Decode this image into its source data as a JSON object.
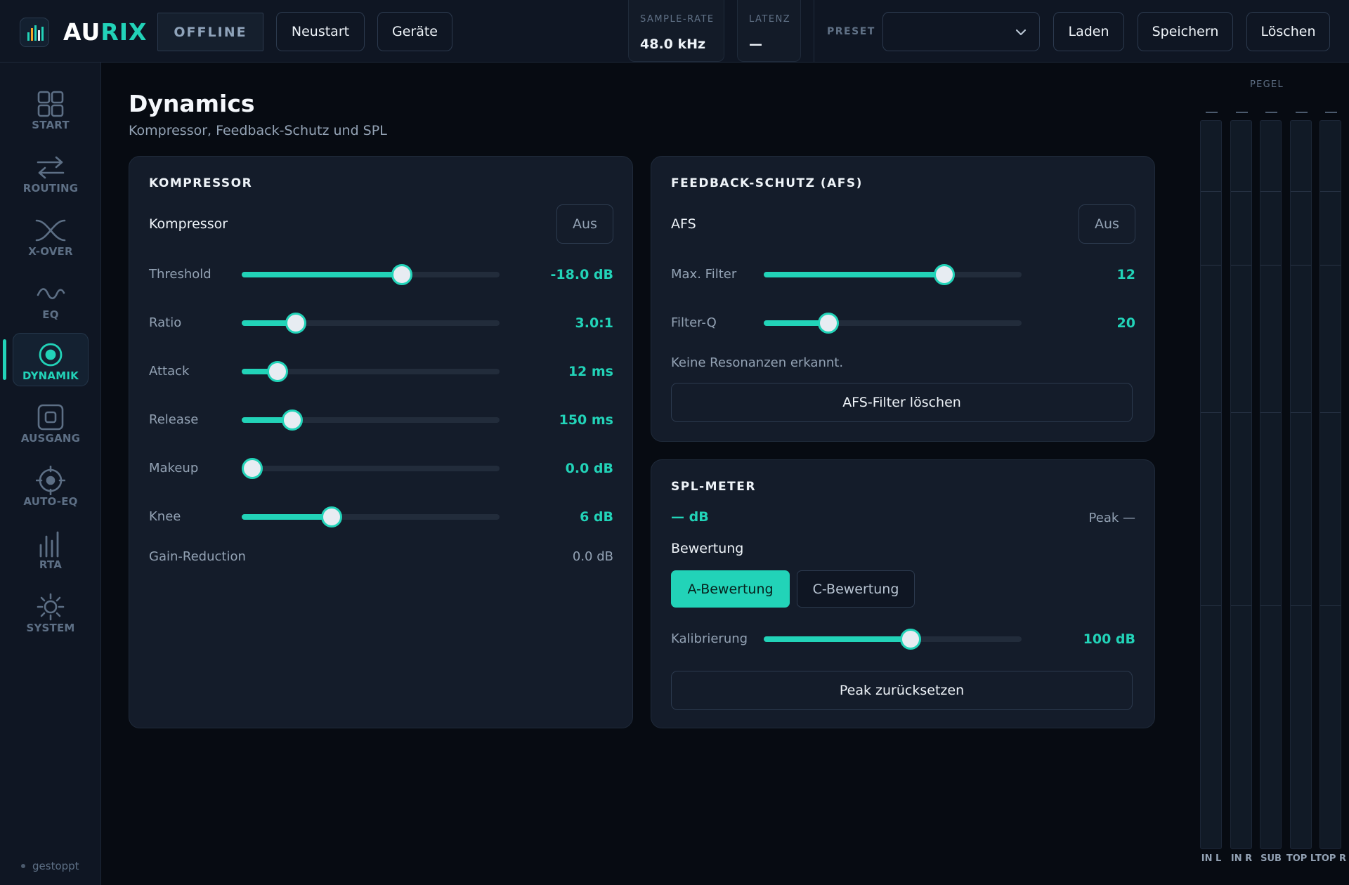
{
  "app": {
    "brand_part1": "AU",
    "brand_part2": "RIX",
    "status_badge": "OFFLINE",
    "restart_label": "Neustart",
    "devices_label": "Geräte",
    "brand_color": "#22d3b8"
  },
  "stats": {
    "sample_rate_label": "SAMPLE-RATE",
    "sample_rate_value": "48.0 kHz",
    "latency_label": "LATENZ",
    "latency_value": "—"
  },
  "preset": {
    "label": "PRESET",
    "selected": "",
    "load_label": "Laden",
    "save_label": "Speichern",
    "delete_label": "Löschen"
  },
  "sidebar": {
    "items": [
      {
        "label": "START",
        "icon": "grid-icon"
      },
      {
        "label": "ROUTING",
        "icon": "arrows-swap-icon"
      },
      {
        "label": "X-OVER",
        "icon": "crossover-icon"
      },
      {
        "label": "EQ",
        "icon": "wave-icon"
      },
      {
        "label": "DYNAMIK",
        "icon": "target-icon",
        "active": true
      },
      {
        "label": "AUSGANG",
        "icon": "output-icon"
      },
      {
        "label": "AUTO-EQ",
        "icon": "crosshair-icon"
      },
      {
        "label": "RTA",
        "icon": "bars-icon"
      },
      {
        "label": "SYSTEM",
        "icon": "gear-icon"
      }
    ],
    "status": "gestoppt"
  },
  "page": {
    "title": "Dynamics",
    "subtitle": "Kompressor, Feedback-Schutz und SPL"
  },
  "compressor": {
    "title": "KOMPRESSOR",
    "enable_label": "Kompressor",
    "toggle_label": "Aus",
    "rows": [
      {
        "label": "Threshold",
        "value": "-18.0 dB",
        "fraction": 0.62
      },
      {
        "label": "Ratio",
        "value": "3.0:1",
        "fraction": 0.21
      },
      {
        "label": "Attack",
        "value": "12 ms",
        "fraction": 0.14
      },
      {
        "label": "Release",
        "value": "150 ms",
        "fraction": 0.195
      },
      {
        "label": "Makeup",
        "value": "0.0 dB",
        "fraction": 0.04
      },
      {
        "label": "Knee",
        "value": "6 dB",
        "fraction": 0.35
      }
    ],
    "gain_reduction_label": "Gain-Reduction",
    "gain_reduction_value": "0.0 dB"
  },
  "afs": {
    "title": "FEEDBACK-SCHUTZ (AFS)",
    "enable_label": "AFS",
    "toggle_label": "Aus",
    "rows": [
      {
        "label": "Max. Filter",
        "value": "12",
        "fraction": 0.7
      },
      {
        "label": "Filter-Q",
        "value": "20",
        "fraction": 0.25
      }
    ],
    "info": "Keine Resonanzen erkannt.",
    "clear_label": "AFS-Filter löschen"
  },
  "spl": {
    "title": "SPL-METER",
    "reading": "— dB",
    "peak": "Peak —",
    "weighting_label": "Bewertung",
    "weighting_a": "A-Bewertung",
    "weighting_c": "C-Bewertung",
    "calibration_label": "Kalibrierung",
    "calibration_value": "100 dB",
    "calibration_fraction": 0.57,
    "reset_label": "Peak zurücksetzen"
  },
  "meters": {
    "title": "PEGEL",
    "channels": [
      "IN L",
      "IN R",
      "SUB",
      "TOP L",
      "TOP R"
    ],
    "peak_readout": "—"
  }
}
